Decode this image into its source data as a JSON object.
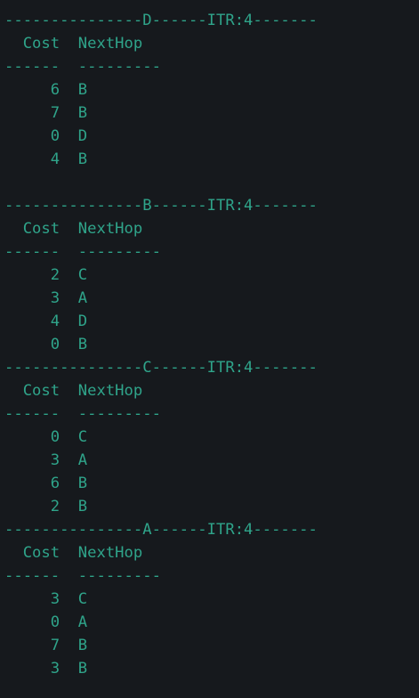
{
  "terminal": {
    "fg_color": "#2fa48a",
    "bg_color": "#16191d",
    "tables": [
      {
        "header": "---------------D------ITR:4-------",
        "columns": "  Cost  NextHop",
        "underline": "------  ---------",
        "rows": [
          "     6  B",
          "     7  B",
          "     0  D",
          "     4  B"
        ]
      },
      {
        "header": "---------------B------ITR:4-------",
        "columns": "  Cost  NextHop",
        "underline": "------  ---------",
        "rows": [
          "     2  C",
          "     3  A",
          "     4  D",
          "     0  B"
        ]
      },
      {
        "header": "---------------C------ITR:4-------",
        "columns": "  Cost  NextHop",
        "underline": "------  ---------",
        "rows": [
          "     0  C",
          "     3  A",
          "     6  B",
          "     2  B"
        ]
      },
      {
        "header": "---------------A------ITR:4-------",
        "columns": "  Cost  NextHop",
        "underline": "------  ---------",
        "rows": [
          "     3  C",
          "     0  A",
          "     7  B",
          "     3  B"
        ]
      }
    ]
  }
}
